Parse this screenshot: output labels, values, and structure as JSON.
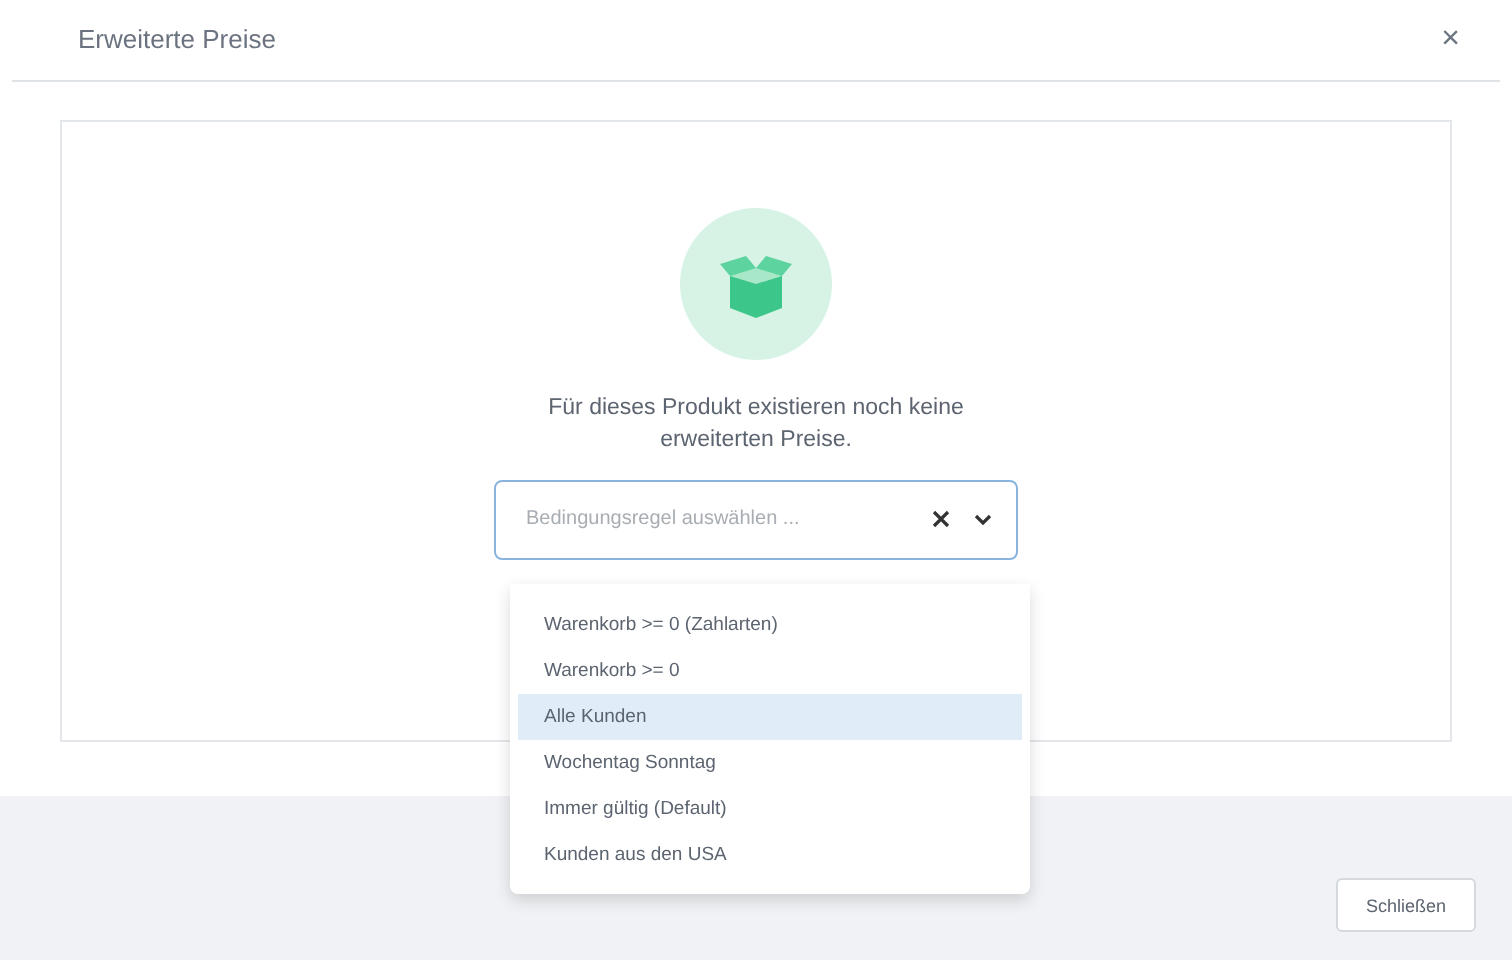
{
  "modal": {
    "title": "Erweiterte Preise",
    "close_icon": "×"
  },
  "empty_state": {
    "message": "Für dieses Produkt existieren noch keine erweiterten Preise."
  },
  "select": {
    "placeholder": "Bedingungsregel auswählen ...",
    "expanded": true,
    "options": [
      {
        "label": "Warenkorb >= 0 (Zahlarten)",
        "selected": false
      },
      {
        "label": "Warenkorb >= 0",
        "selected": false
      },
      {
        "label": "Alle Kunden",
        "selected": true
      },
      {
        "label": "Wochentag Sonntag",
        "selected": false
      },
      {
        "label": "Immer gültig (Default)",
        "selected": false
      },
      {
        "label": "Kunden aus den USA",
        "selected": false
      }
    ]
  },
  "footer": {
    "buttons": [
      "Schließen"
    ]
  }
}
